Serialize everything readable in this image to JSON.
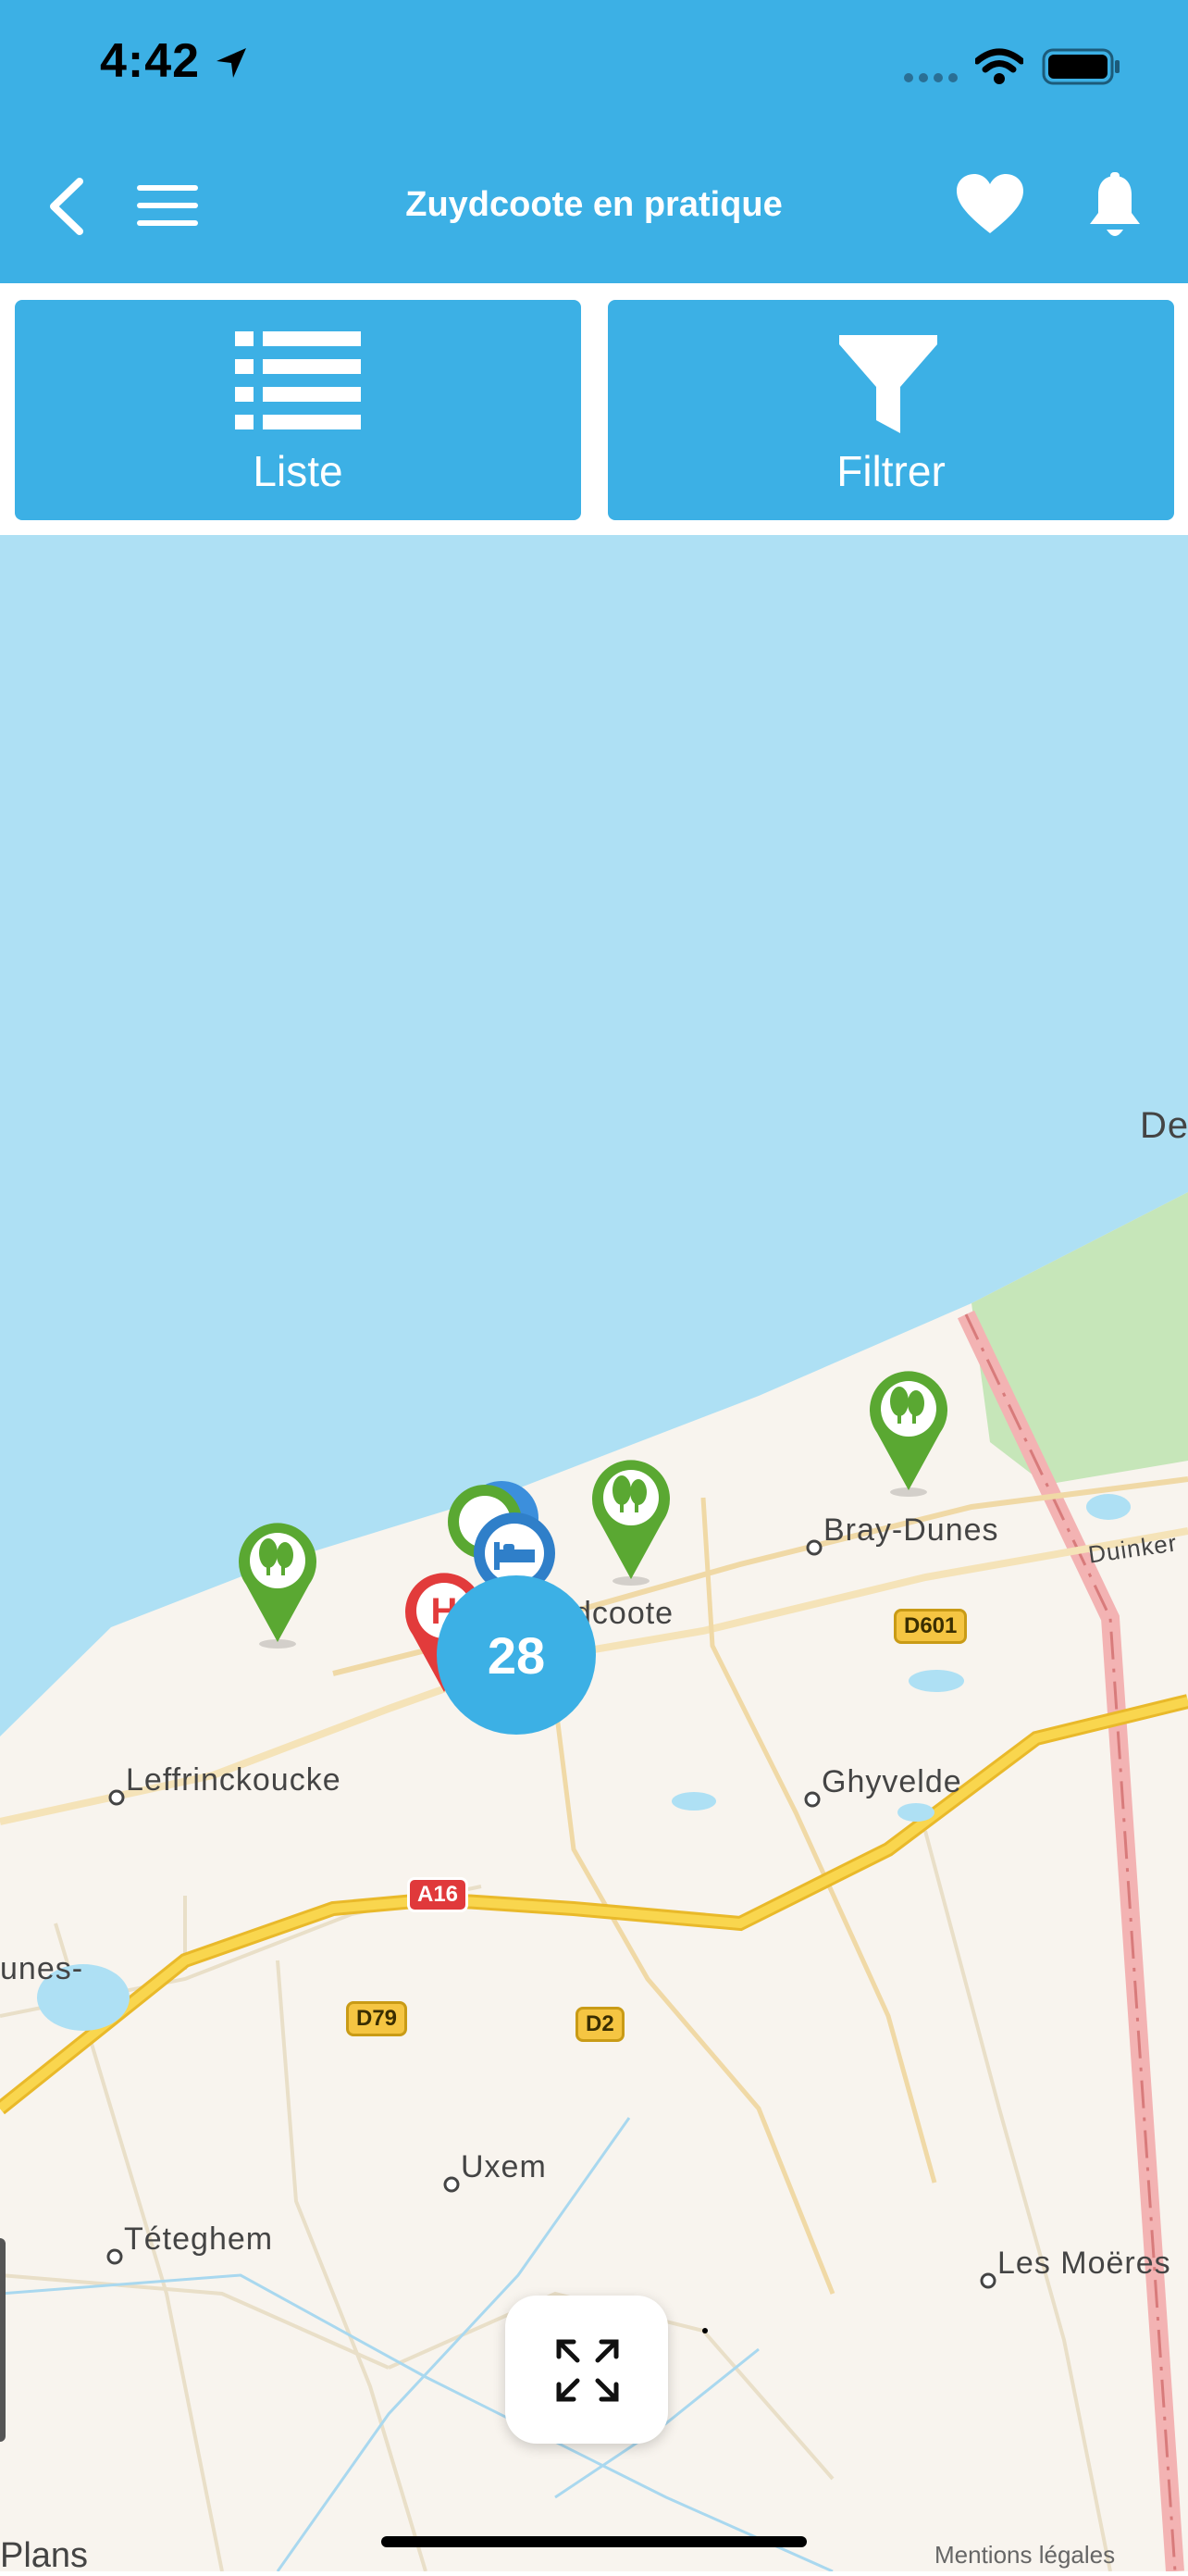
{
  "status_bar": {
    "time": "4:42"
  },
  "header": {
    "title": "Zuydcoote en pratique"
  },
  "toolbar": {
    "list_label": "Liste",
    "filter_label": "Filtrer"
  },
  "map": {
    "places": {
      "leffrinckoucke": "Leffrinckoucke",
      "bray_dunes": "Bray-Dunes",
      "ghyvelde": "Ghyvelde",
      "zuydcoote_partial": "dcoote",
      "dunes_partial": "unes-",
      "uxem": "Uxem",
      "teteghem": "Téteghem",
      "les_moeres": "Les Moëres",
      "de_partial": "De",
      "duinkerke_partial": "Duinker"
    },
    "roads": {
      "a16": "A16",
      "d601": "D601",
      "d79": "D79",
      "d2": "D2"
    },
    "cluster_count": "28",
    "legal": "Mentions légales",
    "attribution": "Plans"
  },
  "colors": {
    "brand": "#3cb0e5",
    "sea": "#aee0f4",
    "land": "#f8f4ee",
    "green_pin": "#5aa832",
    "red_pin": "#e23b3b"
  },
  "icons": [
    "back-icon",
    "menu-icon",
    "heart-icon",
    "bell-icon",
    "list-icon",
    "filter-icon",
    "expand-icon",
    "location-arrow-icon",
    "wifi-icon",
    "battery-icon"
  ]
}
